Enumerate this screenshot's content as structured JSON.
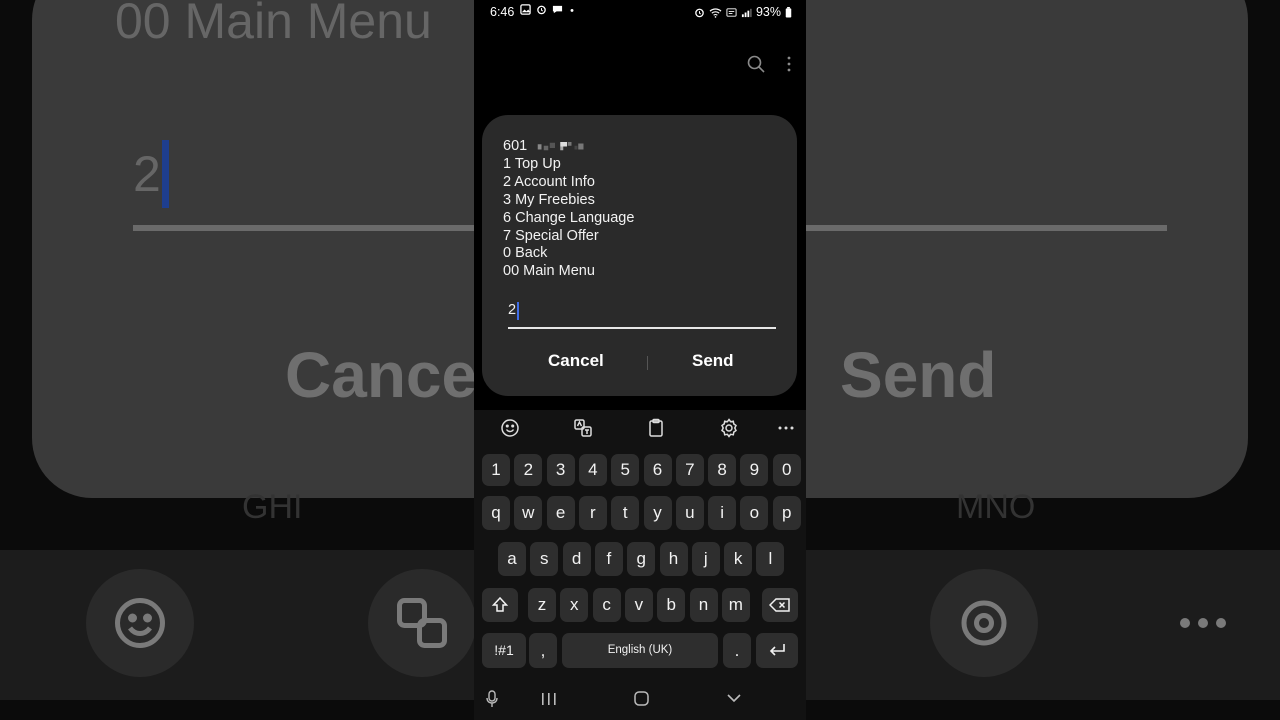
{
  "status_bar": {
    "time": "6:46",
    "battery": "93%"
  },
  "background": {
    "title": "00 Main Menu",
    "input_value": "2",
    "cancel": "Cance",
    "send": "Send",
    "ghi": "GHI",
    "mno": "MNO"
  },
  "dialog": {
    "number": "601",
    "lines": [
      "1 Top Up",
      "2 Account Info",
      "3 My Freebies",
      "6 Change Language",
      "7 Special Offer",
      "0 Back",
      "00 Main Menu"
    ],
    "input_value": "2",
    "cancel_label": "Cancel",
    "send_label": "Send"
  },
  "keyboard": {
    "number_row": [
      "1",
      "2",
      "3",
      "4",
      "5",
      "6",
      "7",
      "8",
      "9",
      "0"
    ],
    "row1": [
      "q",
      "w",
      "e",
      "r",
      "t",
      "y",
      "u",
      "i",
      "o",
      "p"
    ],
    "row2": [
      "a",
      "s",
      "d",
      "f",
      "g",
      "h",
      "j",
      "k",
      "l"
    ],
    "row3": [
      "z",
      "x",
      "c",
      "v",
      "b",
      "n",
      "m"
    ],
    "symbols_label": "!#1",
    "comma_label": ",",
    "space_label": "English (UK)",
    "period_label": "."
  },
  "icons": {
    "search": "search-icon",
    "more": "more-vert-icon",
    "emoji": "emoji-icon",
    "translate": "translate-icon",
    "clipboard": "clipboard-icon",
    "settings": "gear-icon",
    "toolbar_more": "more-horiz-icon",
    "shift": "shift-icon",
    "backspace": "backspace-icon",
    "enter": "enter-icon",
    "mic": "mic-icon"
  }
}
